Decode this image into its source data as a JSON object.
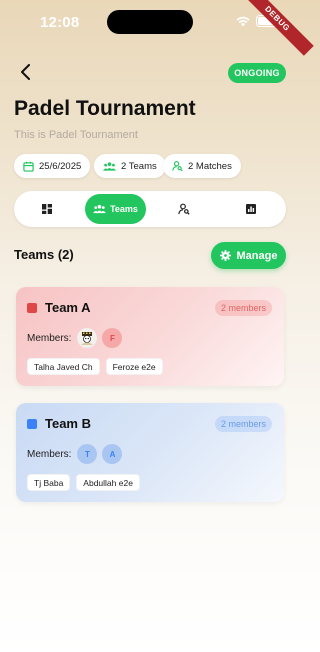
{
  "status_bar": {
    "time": "12:08",
    "debug_label": "DEBUG"
  },
  "header": {
    "status": "ONGOING",
    "title": "Padel Tournament",
    "subtitle": "This is Padel Tournament"
  },
  "chips": {
    "date": "25/6/2025",
    "teams": "2 Teams",
    "matches": "2 Matches"
  },
  "tabs": [
    {
      "name": "overview",
      "icon": "dashboard-icon",
      "label": ""
    },
    {
      "name": "teams",
      "icon": "people-icon",
      "label": "Teams",
      "active": true
    },
    {
      "name": "players",
      "icon": "person-search-icon",
      "label": ""
    },
    {
      "name": "stats",
      "icon": "chart-icon",
      "label": ""
    }
  ],
  "section": {
    "title": "Teams (2)",
    "manage_label": "Manage"
  },
  "teams": [
    {
      "name": "Team A",
      "color": "#e04848",
      "members_count": "2 members",
      "members_label": "Members:",
      "avatars": [
        "photo",
        "F"
      ],
      "member_names": [
        "Talha Javed Ch",
        "Feroze e2e"
      ]
    },
    {
      "name": "Team B",
      "color": "#3b82f6",
      "members_count": "2 members",
      "members_label": "Members:",
      "avatars": [
        "T",
        "A"
      ],
      "member_names": [
        "Tj Baba",
        "Abdullah e2e"
      ]
    }
  ],
  "colors": {
    "accent": "#22c55e"
  }
}
